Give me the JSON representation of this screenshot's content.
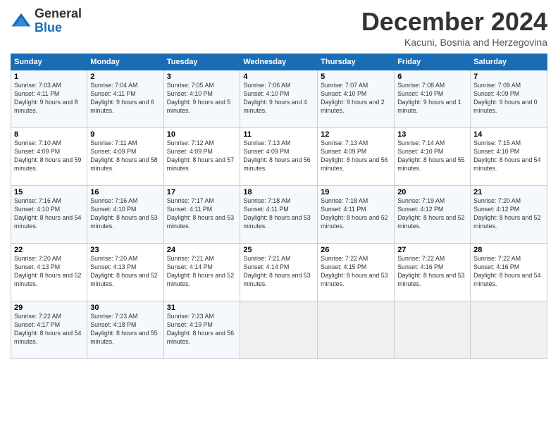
{
  "header": {
    "logo_general": "General",
    "logo_blue": "Blue",
    "title": "December 2024",
    "location": "Kacuni, Bosnia and Herzegovina"
  },
  "weekdays": [
    "Sunday",
    "Monday",
    "Tuesday",
    "Wednesday",
    "Thursday",
    "Friday",
    "Saturday"
  ],
  "weeks": [
    [
      {
        "day": "1",
        "sunrise": "Sunrise: 7:03 AM",
        "sunset": "Sunset: 4:11 PM",
        "daylight": "Daylight: 9 hours and 8 minutes."
      },
      {
        "day": "2",
        "sunrise": "Sunrise: 7:04 AM",
        "sunset": "Sunset: 4:11 PM",
        "daylight": "Daylight: 9 hours and 6 minutes."
      },
      {
        "day": "3",
        "sunrise": "Sunrise: 7:05 AM",
        "sunset": "Sunset: 4:10 PM",
        "daylight": "Daylight: 9 hours and 5 minutes."
      },
      {
        "day": "4",
        "sunrise": "Sunrise: 7:06 AM",
        "sunset": "Sunset: 4:10 PM",
        "daylight": "Daylight: 9 hours and 4 minutes."
      },
      {
        "day": "5",
        "sunrise": "Sunrise: 7:07 AM",
        "sunset": "Sunset: 4:10 PM",
        "daylight": "Daylight: 9 hours and 2 minutes."
      },
      {
        "day": "6",
        "sunrise": "Sunrise: 7:08 AM",
        "sunset": "Sunset: 4:10 PM",
        "daylight": "Daylight: 9 hours and 1 minute."
      },
      {
        "day": "7",
        "sunrise": "Sunrise: 7:09 AM",
        "sunset": "Sunset: 4:09 PM",
        "daylight": "Daylight: 9 hours and 0 minutes."
      }
    ],
    [
      {
        "day": "8",
        "sunrise": "Sunrise: 7:10 AM",
        "sunset": "Sunset: 4:09 PM",
        "daylight": "Daylight: 8 hours and 59 minutes."
      },
      {
        "day": "9",
        "sunrise": "Sunrise: 7:11 AM",
        "sunset": "Sunset: 4:09 PM",
        "daylight": "Daylight: 8 hours and 58 minutes."
      },
      {
        "day": "10",
        "sunrise": "Sunrise: 7:12 AM",
        "sunset": "Sunset: 4:09 PM",
        "daylight": "Daylight: 8 hours and 57 minutes."
      },
      {
        "day": "11",
        "sunrise": "Sunrise: 7:13 AM",
        "sunset": "Sunset: 4:09 PM",
        "daylight": "Daylight: 8 hours and 56 minutes."
      },
      {
        "day": "12",
        "sunrise": "Sunrise: 7:13 AM",
        "sunset": "Sunset: 4:09 PM",
        "daylight": "Daylight: 8 hours and 56 minutes."
      },
      {
        "day": "13",
        "sunrise": "Sunrise: 7:14 AM",
        "sunset": "Sunset: 4:10 PM",
        "daylight": "Daylight: 8 hours and 55 minutes."
      },
      {
        "day": "14",
        "sunrise": "Sunrise: 7:15 AM",
        "sunset": "Sunset: 4:10 PM",
        "daylight": "Daylight: 8 hours and 54 minutes."
      }
    ],
    [
      {
        "day": "15",
        "sunrise": "Sunrise: 7:16 AM",
        "sunset": "Sunset: 4:10 PM",
        "daylight": "Daylight: 8 hours and 54 minutes."
      },
      {
        "day": "16",
        "sunrise": "Sunrise: 7:16 AM",
        "sunset": "Sunset: 4:10 PM",
        "daylight": "Daylight: 8 hours and 53 minutes."
      },
      {
        "day": "17",
        "sunrise": "Sunrise: 7:17 AM",
        "sunset": "Sunset: 4:11 PM",
        "daylight": "Daylight: 8 hours and 53 minutes."
      },
      {
        "day": "18",
        "sunrise": "Sunrise: 7:18 AM",
        "sunset": "Sunset: 4:11 PM",
        "daylight": "Daylight: 8 hours and 53 minutes."
      },
      {
        "day": "19",
        "sunrise": "Sunrise: 7:18 AM",
        "sunset": "Sunset: 4:11 PM",
        "daylight": "Daylight: 8 hours and 52 minutes."
      },
      {
        "day": "20",
        "sunrise": "Sunrise: 7:19 AM",
        "sunset": "Sunset: 4:12 PM",
        "daylight": "Daylight: 8 hours and 52 minutes."
      },
      {
        "day": "21",
        "sunrise": "Sunrise: 7:20 AM",
        "sunset": "Sunset: 4:12 PM",
        "daylight": "Daylight: 8 hours and 52 minutes."
      }
    ],
    [
      {
        "day": "22",
        "sunrise": "Sunrise: 7:20 AM",
        "sunset": "Sunset: 4:13 PM",
        "daylight": "Daylight: 8 hours and 52 minutes."
      },
      {
        "day": "23",
        "sunrise": "Sunrise: 7:20 AM",
        "sunset": "Sunset: 4:13 PM",
        "daylight": "Daylight: 8 hours and 52 minutes."
      },
      {
        "day": "24",
        "sunrise": "Sunrise: 7:21 AM",
        "sunset": "Sunset: 4:14 PM",
        "daylight": "Daylight: 8 hours and 52 minutes."
      },
      {
        "day": "25",
        "sunrise": "Sunrise: 7:21 AM",
        "sunset": "Sunset: 4:14 PM",
        "daylight": "Daylight: 8 hours and 53 minutes."
      },
      {
        "day": "26",
        "sunrise": "Sunrise: 7:22 AM",
        "sunset": "Sunset: 4:15 PM",
        "daylight": "Daylight: 8 hours and 53 minutes."
      },
      {
        "day": "27",
        "sunrise": "Sunrise: 7:22 AM",
        "sunset": "Sunset: 4:16 PM",
        "daylight": "Daylight: 8 hours and 53 minutes."
      },
      {
        "day": "28",
        "sunrise": "Sunrise: 7:22 AM",
        "sunset": "Sunset: 4:16 PM",
        "daylight": "Daylight: 8 hours and 54 minutes."
      }
    ],
    [
      {
        "day": "29",
        "sunrise": "Sunrise: 7:22 AM",
        "sunset": "Sunset: 4:17 PM",
        "daylight": "Daylight: 8 hours and 54 minutes."
      },
      {
        "day": "30",
        "sunrise": "Sunrise: 7:23 AM",
        "sunset": "Sunset: 4:18 PM",
        "daylight": "Daylight: 8 hours and 55 minutes."
      },
      {
        "day": "31",
        "sunrise": "Sunrise: 7:23 AM",
        "sunset": "Sunset: 4:19 PM",
        "daylight": "Daylight: 8 hours and 56 minutes."
      },
      null,
      null,
      null,
      null
    ]
  ]
}
